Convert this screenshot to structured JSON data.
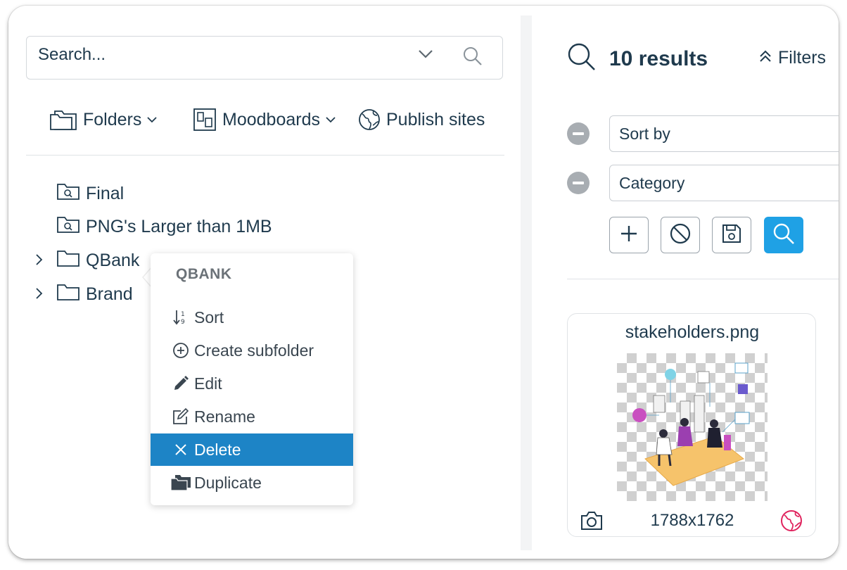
{
  "search": {
    "placeholder": "Search..."
  },
  "nav": {
    "folders": "Folders",
    "moodboards": "Moodboards",
    "publish": "Publish sites"
  },
  "tree": {
    "items": [
      {
        "label": "Final",
        "icon": "saved-search-folder-icon"
      },
      {
        "label": "PNG's Larger than 1MB",
        "icon": "saved-search-folder-icon"
      },
      {
        "label": "QBank",
        "icon": "folder-icon"
      },
      {
        "label": "Brand",
        "icon": "folder-icon"
      }
    ]
  },
  "context_menu": {
    "title": "QBANK",
    "items": [
      {
        "label": "Sort",
        "icon": "sort-icon"
      },
      {
        "label": "Create subfolder",
        "icon": "plus-circle-icon"
      },
      {
        "label": "Edit",
        "icon": "pencil-icon"
      },
      {
        "label": "Rename",
        "icon": "edit-square-icon"
      },
      {
        "label": "Delete",
        "icon": "close-icon",
        "active": true
      },
      {
        "label": "Duplicate",
        "icon": "folders-icon"
      }
    ]
  },
  "results": {
    "title": "10 results",
    "filters_label": "Filters",
    "filter_rows": [
      {
        "label": "Sort by"
      },
      {
        "label": "Category"
      }
    ]
  },
  "card": {
    "filename": "stakeholders.png",
    "dimensions": "1788x1762"
  },
  "colors": {
    "accent": "#1fa1e5",
    "menu_active": "#1d84c6",
    "text": "#1f3a4d",
    "globe_pink": "#e0245e"
  }
}
